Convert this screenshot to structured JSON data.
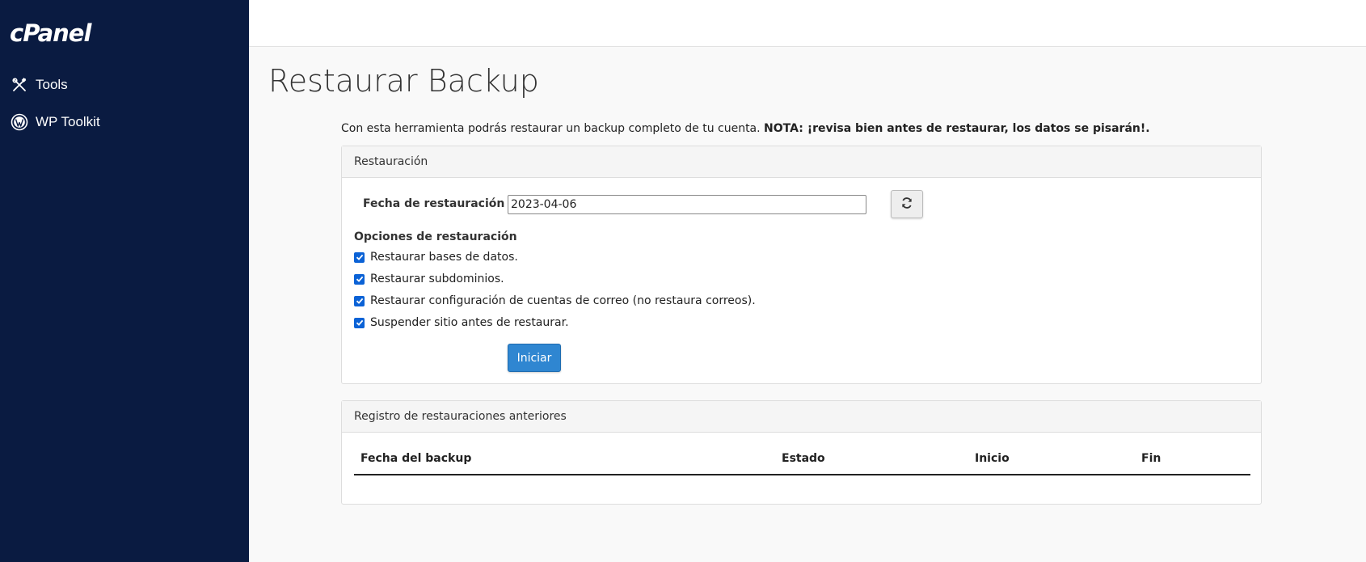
{
  "sidebar": {
    "logo": "cPanel",
    "items": [
      {
        "label": "Tools",
        "icon": "tools-icon"
      },
      {
        "label": "WP Toolkit",
        "icon": "wordpress-icon"
      }
    ]
  },
  "page": {
    "title": "Restaurar Backup",
    "intro_text": "Con esta herramienta podrás restaurar un backup completo de tu cuenta.",
    "intro_note": "NOTA: ¡revisa bien antes de restaurar, los datos se pisarán!."
  },
  "restore_panel": {
    "heading": "Restauración",
    "date_label": "Fecha de restauración",
    "date_value": "2023-04-06",
    "refresh_icon": "refresh-icon",
    "options_title": "Opciones de restauración",
    "options": [
      {
        "label": "Restaurar bases de datos.",
        "checked": true
      },
      {
        "label": "Restaurar subdominios.",
        "checked": true
      },
      {
        "label": "Restaurar configuración de cuentas de correo (no restaura correos).",
        "checked": true
      },
      {
        "label": "Suspender sitio antes de restaurar.",
        "checked": true
      }
    ],
    "start_label": "Iniciar"
  },
  "history_panel": {
    "heading": "Registro de restauraciones anteriores",
    "columns": [
      "Fecha del backup",
      "Estado",
      "Inicio",
      "Fin"
    ],
    "rows": []
  },
  "colors": {
    "sidebar_bg": "#0a1b41",
    "primary_button": "#2f86d1",
    "checkbox": "#0b62d6"
  }
}
